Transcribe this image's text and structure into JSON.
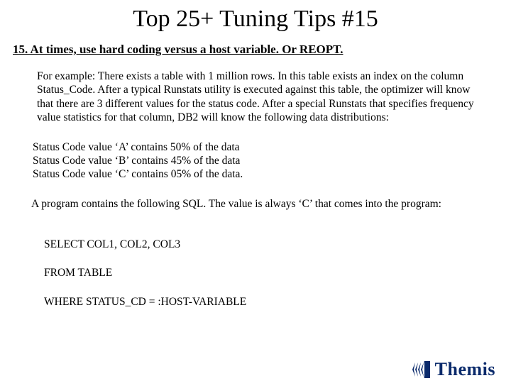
{
  "title": "Top 25+ Tuning Tips #15",
  "heading": "15. At times, use hard coding versus a host variable.  Or REOPT.",
  "paragraph1": "For example: There exists a table with 1 million rows.  In this table exists an index on the column Status_Code.  After a typical  Runstats utility is executed against this table, the optimizer will know that there are 3 different values for the status code. After a special Runstats that specifies frequency value statistics for that column, DB2 will know the following data distributions:",
  "distributions": [
    "Status Code value ‘A’ contains 50% of the data",
    "Status Code value ‘B’ contains 45% of the data",
    "Status Code value ‘C’ contains  05% of the data."
  ],
  "paragraph2": "A program contains the following SQL.  The value is always ‘C’ that comes into the program:",
  "sql": {
    "line1": "SELECT COL1, COL2, COL3",
    "line2": "FROM TABLE",
    "line3": "WHERE STATUS_CD = :HOST-VARIABLE"
  },
  "logo_text": "Themis"
}
